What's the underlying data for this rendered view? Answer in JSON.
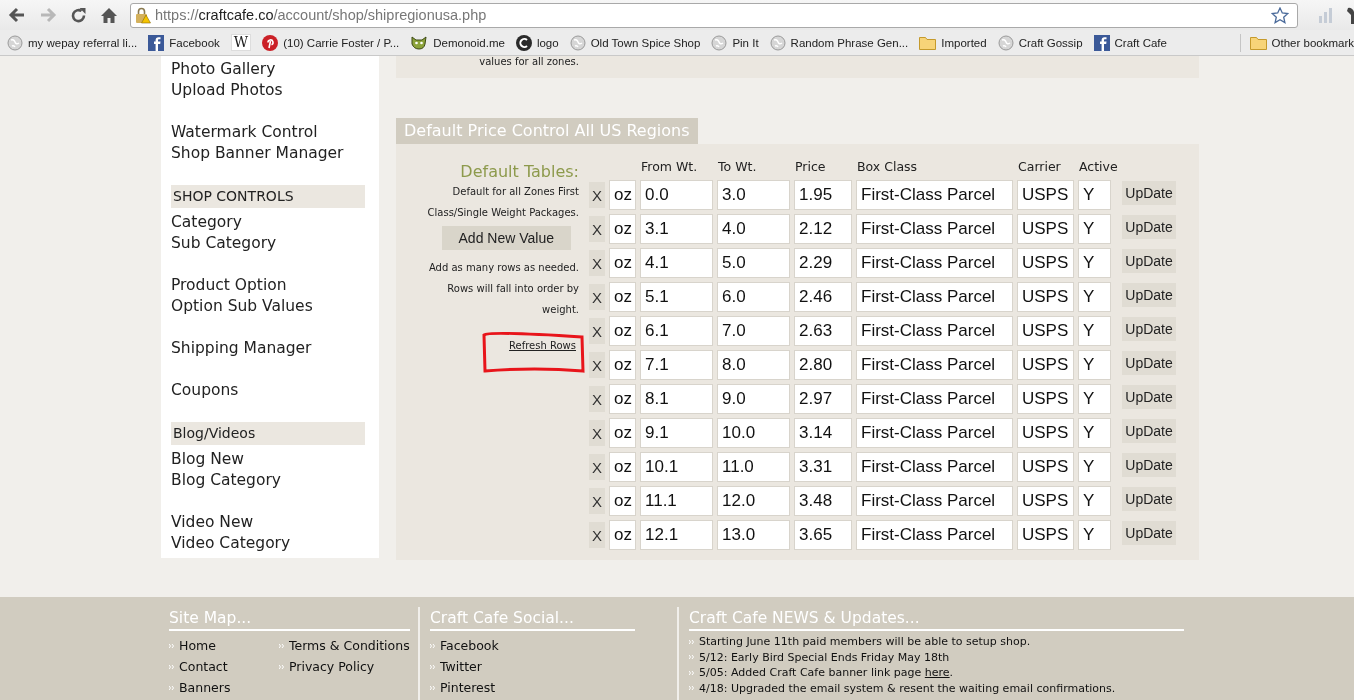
{
  "browser": {
    "nav": [
      {
        "disabled": false
      },
      {
        "disabled": true
      },
      {
        "disabled": false
      },
      {
        "disabled": false
      }
    ],
    "address": {
      "scheme": "https://",
      "host": "craftcafe.co",
      "path": "/account/shop/shipregionusa.php"
    },
    "bookmarks": [
      {
        "label": "my wepay referral li..."
      },
      {
        "label": "Facebook"
      },
      {
        "icon_text": "W"
      },
      {
        "label": "(10) Carrie Foster / P..."
      },
      {
        "label": "Demonoid.me"
      },
      {
        "label": "logo"
      },
      {
        "label": "Old Town Spice Shop"
      },
      {
        "label": "Pin It"
      },
      {
        "label": "Random Phrase Gen..."
      },
      {
        "label": "Imported"
      },
      {
        "label": "Craft Gossip"
      },
      {
        "label": "Craft Cafe"
      }
    ],
    "other_bookmarks": {
      "label": "Other bookmark"
    }
  },
  "sidebar": {
    "groups": [
      {
        "items": [
          "Photo Gallery",
          "Upload Photos"
        ]
      },
      {
        "items": [
          "Watermark Control",
          "Shop Banner Manager"
        ]
      },
      {
        "header": "SHOP CONTROLS",
        "items": [
          "Category",
          "Sub Category"
        ]
      },
      {
        "items": [
          "Product Option",
          "Option Sub Values"
        ]
      },
      {
        "items": [
          "Shipping Manager"
        ]
      },
      {
        "items": [
          "Coupons"
        ]
      },
      {
        "header": "Blog/Videos",
        "items": [
          "Blog New",
          "Blog Category"
        ]
      },
      {
        "items": [
          "Video New",
          "Video Category"
        ]
      }
    ]
  },
  "top_note": "values for all zones.",
  "panel": {
    "title": "Default Price Control All US Regions",
    "info": {
      "heading": "Default Tables:",
      "description": "Default for all Zones First Class/Single Weight Packages.",
      "add_button": "Add New Value",
      "help": "Add as many rows as needed. Rows will fall into order by weight.",
      "refresh_link": "Refresh Rows"
    },
    "columns": [
      "From Wt.",
      "To Wt.",
      "Price",
      "Box Class",
      "Carrier",
      "Active"
    ],
    "rows": [
      {
        "remove": "X",
        "unit": "oz",
        "from": "0.0",
        "to": "3.0",
        "price": "1.95",
        "box_class": "First-Class Parcel",
        "carrier": "USPS",
        "active": "Y",
        "action": "UpDate"
      },
      {
        "remove": "X",
        "unit": "oz",
        "from": "3.1",
        "to": "4.0",
        "price": "2.12",
        "box_class": "First-Class Parcel",
        "carrier": "USPS",
        "active": "Y",
        "action": "UpDate"
      },
      {
        "remove": "X",
        "unit": "oz",
        "from": "4.1",
        "to": "5.0",
        "price": "2.29",
        "box_class": "First-Class Parcel",
        "carrier": "USPS",
        "active": "Y",
        "action": "UpDate"
      },
      {
        "remove": "X",
        "unit": "oz",
        "from": "5.1",
        "to": "6.0",
        "price": "2.46",
        "box_class": "First-Class Parcel",
        "carrier": "USPS",
        "active": "Y",
        "action": "UpDate"
      },
      {
        "remove": "X",
        "unit": "oz",
        "from": "6.1",
        "to": "7.0",
        "price": "2.63",
        "box_class": "First-Class Parcel",
        "carrier": "USPS",
        "active": "Y",
        "action": "UpDate"
      },
      {
        "remove": "X",
        "unit": "oz",
        "from": "7.1",
        "to": "8.0",
        "price": "2.80",
        "box_class": "First-Class Parcel",
        "carrier": "USPS",
        "active": "Y",
        "action": "UpDate"
      },
      {
        "remove": "X",
        "unit": "oz",
        "from": "8.1",
        "to": "9.0",
        "price": "2.97",
        "box_class": "First-Class Parcel",
        "carrier": "USPS",
        "active": "Y",
        "action": "UpDate"
      },
      {
        "remove": "X",
        "unit": "oz",
        "from": "9.1",
        "to": "10.0",
        "price": "3.14",
        "box_class": "First-Class Parcel",
        "carrier": "USPS",
        "active": "Y",
        "action": "UpDate"
      },
      {
        "remove": "X",
        "unit": "oz",
        "from": "10.1",
        "to": "11.0",
        "price": "3.31",
        "box_class": "First-Class Parcel",
        "carrier": "USPS",
        "active": "Y",
        "action": "UpDate"
      },
      {
        "remove": "X",
        "unit": "oz",
        "from": "11.1",
        "to": "12.0",
        "price": "3.48",
        "box_class": "First-Class Parcel",
        "carrier": "USPS",
        "active": "Y",
        "action": "UpDate"
      },
      {
        "remove": "X",
        "unit": "oz",
        "from": "12.1",
        "to": "13.0",
        "price": "3.65",
        "box_class": "First-Class Parcel",
        "carrier": "USPS",
        "active": "Y",
        "action": "UpDate"
      }
    ]
  },
  "footer": {
    "site_map": {
      "title": "Site Map...",
      "columns": [
        [
          "Home",
          "Contact",
          "Banners"
        ],
        [
          "Terms & Conditions",
          "Privacy Policy"
        ]
      ]
    },
    "social": {
      "title": "Craft Cafe Social...",
      "links": [
        "Facebook",
        "Twitter",
        "Pinterest"
      ]
    },
    "news": {
      "title": "Craft Cafe NEWS & Updates...",
      "items": [
        {
          "text": "Starting June 11th paid members will be able to setup shop."
        },
        {
          "text": "5/12: Early Bird Special Ends Friday May 18th"
        },
        {
          "text": "5/05: Added Craft Cafe banner link page ",
          "link": "here",
          "after": "."
        },
        {
          "text": "4/18: Upgraded the email system & resent the waiting email confirmations."
        }
      ]
    }
  }
}
